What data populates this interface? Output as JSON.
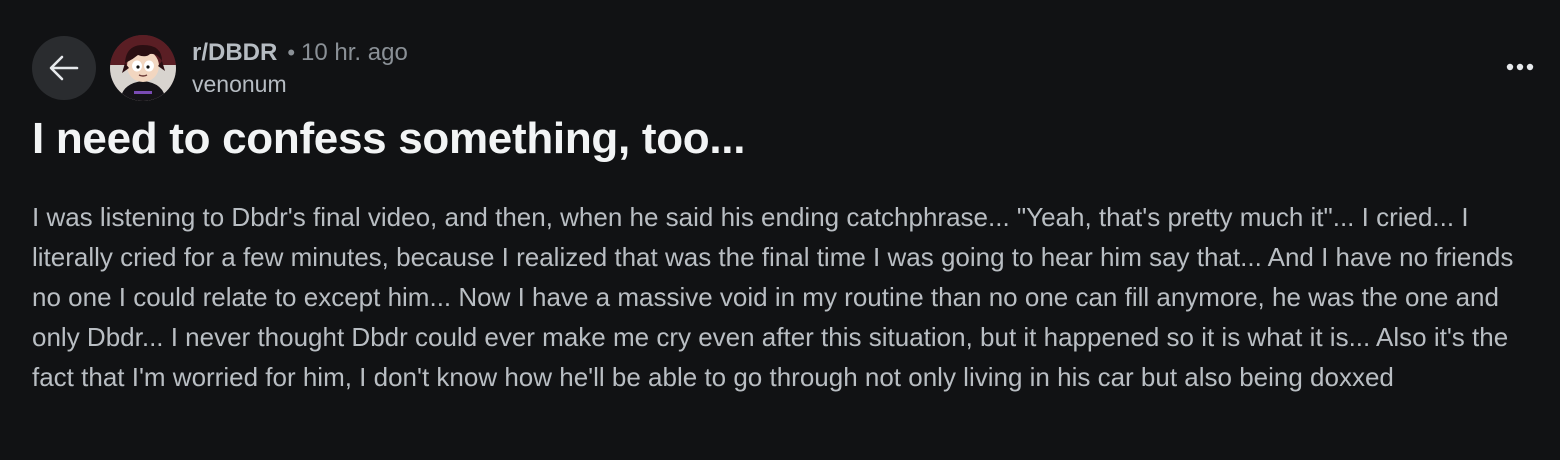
{
  "header": {
    "subreddit": "r/DBDR",
    "separator": "•",
    "time": "10 hr. ago",
    "author": "venonum"
  },
  "icons": {
    "back": "arrow-left-icon",
    "more": "more-horizontal-icon",
    "avatar": "user-avatar"
  },
  "post": {
    "title": "I need to confess something, too...",
    "body": "I was listening to Dbdr's final video, and then, when he said his ending catchphrase... \"Yeah, that's pretty much it\"... I cried... I literally cried for a few minutes, because I realized that was the final time I was going to hear him say that... And I have no friends no one I could relate to except him... Now I have a massive void in my routine than no one can fill anymore, he was the one and only Dbdr... I never thought Dbdr could ever make me cry even after this situation, but it happened so it is what it is... Also it's the fact that I'm worried for him, I don't know how he'll be able to go through not only living in his car but also being doxxed"
  },
  "colors": {
    "background": "#111214",
    "button_bg": "#2a2c2f",
    "title": "#f2f4f5",
    "body_text": "#b9bec3",
    "meta_text": "#8a9096"
  }
}
